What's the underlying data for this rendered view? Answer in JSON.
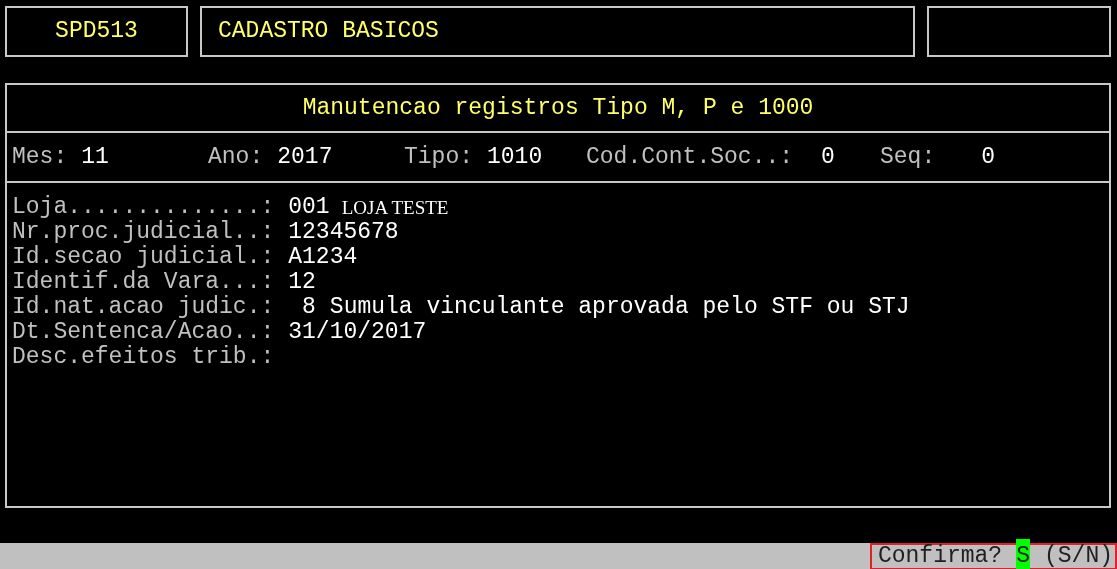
{
  "header": {
    "program_code": "SPD513",
    "module_title": "CADASTRO BASICOS"
  },
  "panel": {
    "title": "Manutencao registros Tipo M, P e 1000",
    "info_fields": [
      {
        "label": "Mes:",
        "value": "11"
      },
      {
        "label": "Ano:",
        "value": "2017"
      },
      {
        "label": "Tipo:",
        "value": "1010"
      },
      {
        "label": "Cod.Cont.Soc..:",
        "value": "0"
      },
      {
        "label": "Seq:",
        "value": "0"
      }
    ],
    "form_fields": [
      {
        "label": "Loja..............:",
        "value": "001",
        "description": "LOJA TESTE",
        "kind": "serif"
      },
      {
        "label": "Nr.proc.judicial..:",
        "value": "12345678"
      },
      {
        "label": "Id.secao judicial.:",
        "value": "A1234"
      },
      {
        "label": "Identif.da Vara...:",
        "value": "12"
      },
      {
        "label": "Id.nat.acao judic.:",
        "value": " 8",
        "description": "Sumula vinculante aprovada pelo STF ou STJ",
        "kind": "mono"
      },
      {
        "label": "Dt.Sentenca/Acao..:",
        "value": "31/10/2017"
      },
      {
        "label": "Desc.efeitos trib.:"
      }
    ]
  },
  "status_bar": {
    "prompt": "Confirma?",
    "answer": "S",
    "options": "(S/N)",
    "highlighted": true
  }
}
